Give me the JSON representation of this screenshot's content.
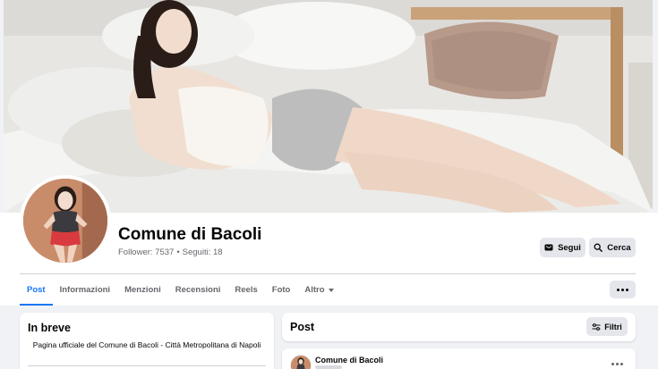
{
  "profile": {
    "name": "Comune di Bacoli",
    "followers_label": "Follower: 7537",
    "meta_separator": "•",
    "following_label": "Seguiti: 18"
  },
  "actions": {
    "follow_label": "Segui",
    "search_label": "Cerca",
    "follow_icon": "messenger-icon",
    "search_icon": "search-icon"
  },
  "tabs": [
    {
      "label": "Post",
      "active": true
    },
    {
      "label": "Informazioni",
      "active": false
    },
    {
      "label": "Menzioni",
      "active": false
    },
    {
      "label": "Recensioni",
      "active": false
    },
    {
      "label": "Reels",
      "active": false
    },
    {
      "label": "Foto",
      "active": false
    },
    {
      "label": "Altro",
      "active": false
    }
  ],
  "intro": {
    "title": "In breve",
    "description": "Pagina ufficiale del Comune di Bacoli - Città Metropolitana di Napoli"
  },
  "posts": {
    "title": "Post",
    "filter_label": "Filtri",
    "filter_icon": "sliders-icon",
    "first_post_author": "Comune di Bacoli"
  },
  "colors": {
    "accent": "#1877f2",
    "button_bg": "#e4e6eb",
    "page_bg": "#f0f2f5",
    "secondary_text": "#65676b"
  }
}
